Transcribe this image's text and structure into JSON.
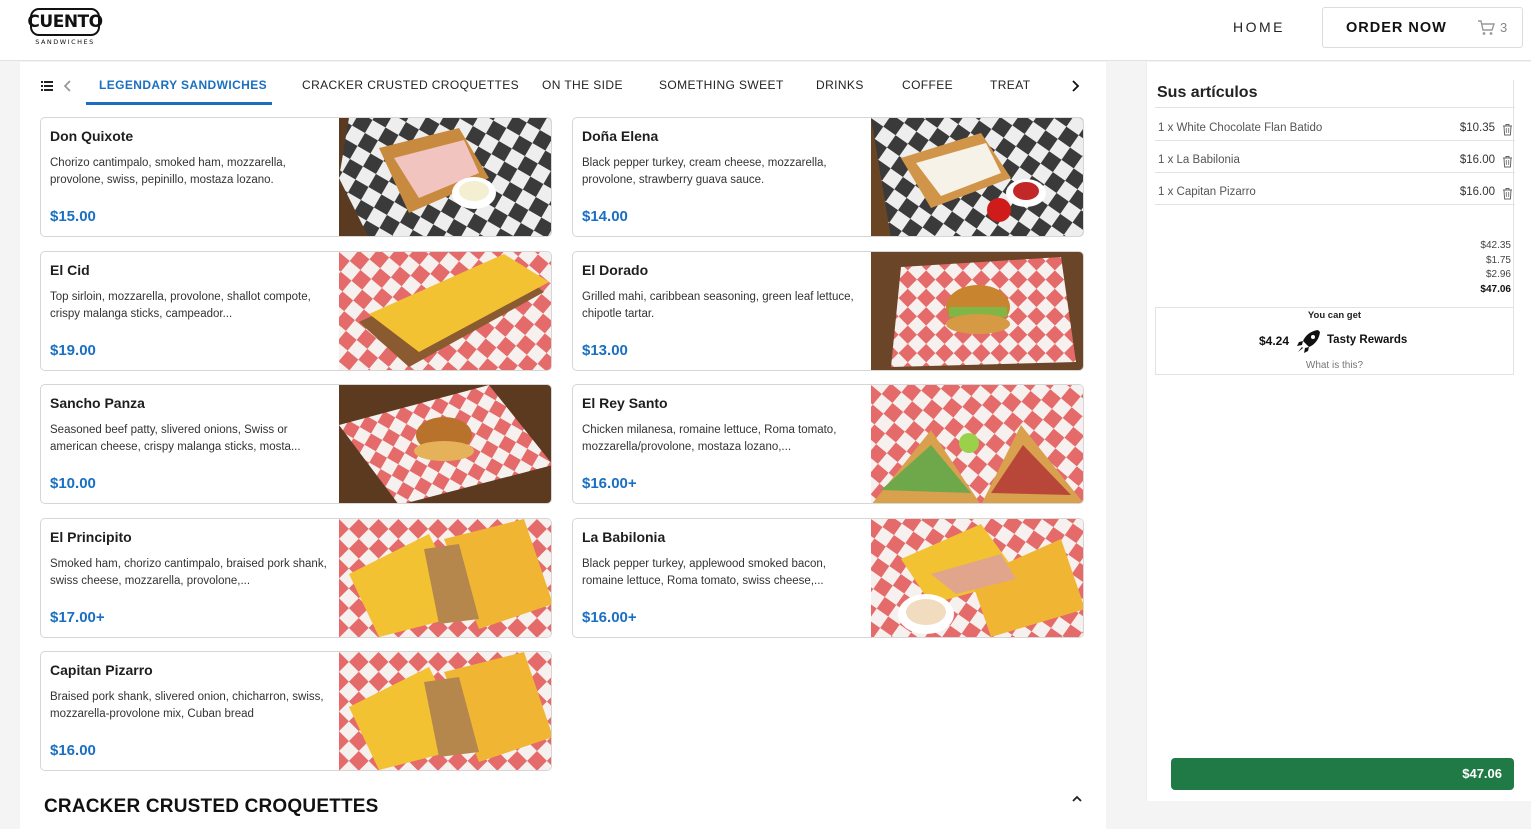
{
  "brand": {
    "name": "CUENTO",
    "sub": "SANDWICHES"
  },
  "nav": {
    "home": "HOME",
    "order_now": "ORDER NOW",
    "cart_count": "3"
  },
  "tabs": [
    {
      "label": "LEGENDARY SANDWICHES",
      "active": true
    },
    {
      "label": "CRACKER CRUSTED CROQUETTES"
    },
    {
      "label": "ON THE SIDE"
    },
    {
      "label": "SOMETHING SWEET"
    },
    {
      "label": "DRINKS"
    },
    {
      "label": "COFFEE"
    },
    {
      "label": "TREAT"
    }
  ],
  "menu": [
    {
      "name": "Don Quixote",
      "desc": "Chorizo cantimpalo, smoked ham, mozzarella, provolone, swiss, pepinillo, mostaza lozano.",
      "price": "$15.00"
    },
    {
      "name": "Doña Elena",
      "desc": "Black pepper turkey, cream cheese, mozzarella, provolone, strawberry guava sauce.",
      "price": "$14.00"
    },
    {
      "name": "El Cid",
      "desc": "Top sirloin, mozzarella, provolone, shallot compote, crispy malanga sticks, campeador...",
      "price": "$19.00"
    },
    {
      "name": "El Dorado",
      "desc": "Grilled mahi, caribbean seasoning, green leaf lettuce, chipotle tartar.",
      "price": "$13.00"
    },
    {
      "name": "Sancho Panza",
      "desc": "Seasoned beef patty, slivered onions, Swiss or american cheese, crispy malanga sticks, mosta...",
      "price": "$10.00"
    },
    {
      "name": "El Rey Santo",
      "desc": "Chicken milanesa, romaine lettuce, Roma tomato, mozzarella/provolone, mostaza lozano,...",
      "price": "$16.00+"
    },
    {
      "name": "El Principito",
      "desc": "Smoked ham, chorizo cantimpalo, braised pork shank, swiss cheese, mozzarella, provolone,...",
      "price": "$17.00+"
    },
    {
      "name": "La Babilonia",
      "desc": "Black pepper turkey, applewood smoked bacon, romaine lettuce, Roma tomato, swiss cheese,...",
      "price": "$16.00+"
    },
    {
      "name": "Capitan Pizarro",
      "desc": "Braised pork shank, slivered onion, chicharron, swiss, mozzarella-provolone mix, Cuban bread",
      "price": "$16.00"
    }
  ],
  "next_section": "CRACKER CRUSTED CROQUETTES",
  "cart": {
    "title": "Sus artículos",
    "items": [
      {
        "label": "1 x White Chocolate Flan Batido",
        "price": "$10.35"
      },
      {
        "label": "1 x La Babilonia",
        "price": "$16.00"
      },
      {
        "label": "1 x Capitan Pizarro",
        "price": "$16.00"
      }
    ],
    "totals": {
      "subtotal": "$42.35",
      "fee": "$1.75",
      "tax": "$2.96",
      "total": "$47.06"
    },
    "rewards": {
      "top": "You can get",
      "amount": "$4.24",
      "label": "Tasty Rewards",
      "link": "What is this?"
    },
    "checkout": "$47.06"
  },
  "colors": {
    "accent": "#1a6fc2",
    "checkout": "#1f7a45"
  }
}
